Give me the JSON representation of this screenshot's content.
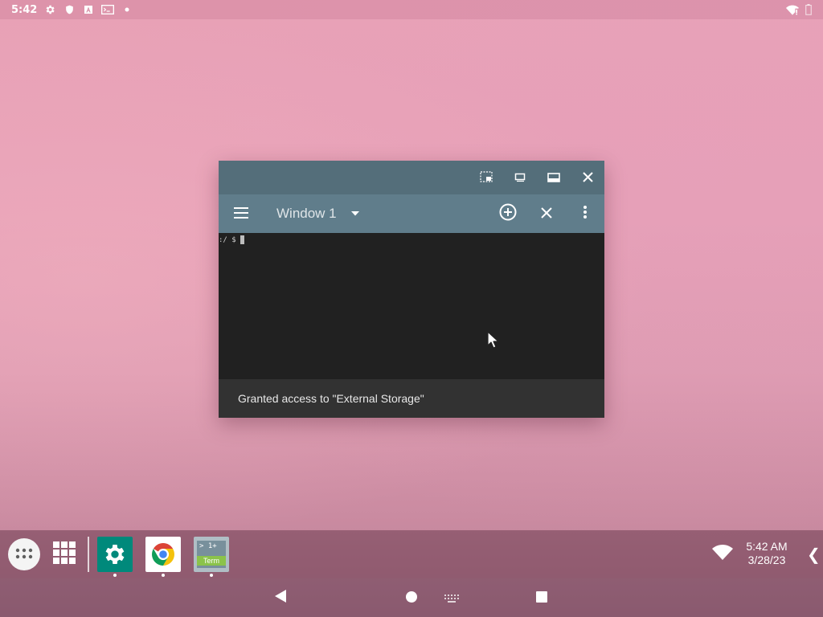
{
  "status_bar": {
    "time": "5:42",
    "left_icons": [
      "gear-icon",
      "shield-icon",
      "font-a-icon",
      "terminal-notification-icon",
      "dot-icon"
    ],
    "right_icons": [
      "wifi-alert-icon",
      "battery-icon"
    ]
  },
  "window": {
    "title": "Window 1",
    "titlebar_controls": [
      "pip-icon",
      "restore-icon",
      "maximize-icon",
      "close-icon"
    ],
    "terminal_prompt": ":/ $",
    "snackbar_message": "Granted access to \"External Storage\""
  },
  "taskbar": {
    "pinned_apps": [
      {
        "name": "Settings",
        "icon": "settings-gear-icon",
        "color": "#00897b"
      },
      {
        "name": "Chrome",
        "icon": "chrome-icon",
        "color": "#ffffff"
      },
      {
        "name": "Terminal",
        "icon": "terminal-app-icon",
        "color": "#b0bec5",
        "tile_top": "> 1+",
        "tile_label": "Term"
      }
    ],
    "clock_time": "5:42 AM",
    "clock_date": "3/28/23",
    "expand_glyph": "❮"
  },
  "navbar": {
    "buttons": [
      "back-icon",
      "home-icon",
      "keyboard-icon",
      "recents-icon"
    ]
  },
  "colors": {
    "titlebar": "#546e7a",
    "app_bar": "#607d8b",
    "terminal_bg": "#212121",
    "snackbar": "#323232",
    "wallpaper": "#e6a0b6"
  }
}
